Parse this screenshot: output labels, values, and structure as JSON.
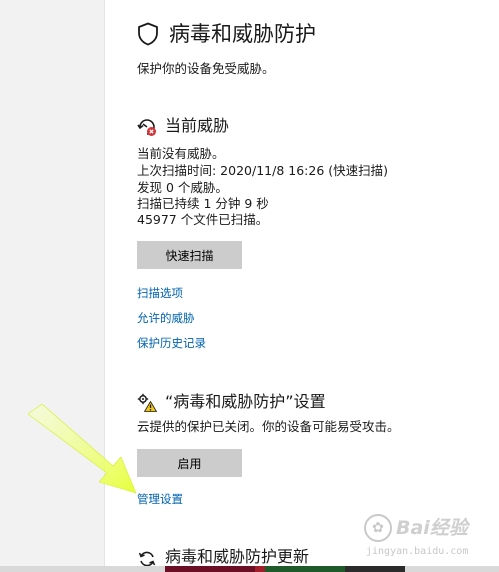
{
  "page": {
    "title": "病毒和威胁防护",
    "subtitle": "保护你的设备免受威胁。",
    "icon": "shield-icon"
  },
  "current_threats": {
    "title": "当前威胁",
    "icon": "threat-scan-icon",
    "lines": [
      "当前没有威胁。",
      "上次扫描时间: 2020/11/8 16:26 (快速扫描)",
      "发现 0 个威胁。",
      "扫描已持续 1 分钟 9 秒",
      "45977 个文件已扫描。"
    ],
    "quick_scan_label": "快速扫描",
    "links": [
      "扫描选项",
      "允许的威胁",
      "保护历史记录"
    ]
  },
  "protection_settings": {
    "title": "“病毒和威胁防护”设置",
    "icon": "settings-warning-icon",
    "status": "云提供的保护已关闭。你的设备可能易受攻击。",
    "enable_label": "启用",
    "manage_link": "管理设置"
  },
  "updates": {
    "title": "病毒和威胁防护更新",
    "icon": "update-refresh-icon"
  },
  "watermark": {
    "brand": "Bai经验",
    "url": "jingyan.baidu.com"
  },
  "colors": {
    "link": "#0063b1",
    "button_bg": "#cccccc",
    "sidebar_bg": "#f2f2f2",
    "arrow": "#e6ff3a",
    "warning": "#f2c811"
  }
}
